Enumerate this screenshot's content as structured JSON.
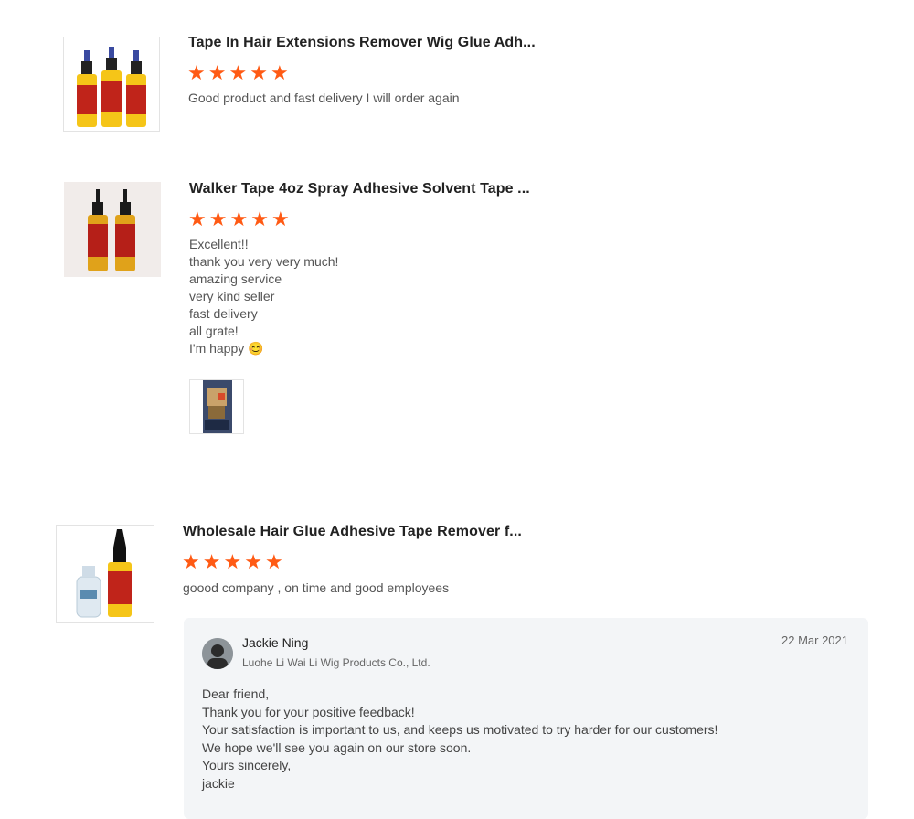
{
  "reviews": [
    {
      "product_title": "Tape In Hair Extensions Remover Wig Glue Adh...",
      "rating": 5,
      "text": "Good product and fast delivery I will order again"
    },
    {
      "product_title": "Walker Tape 4oz Spray Adhesive Solvent Tape ...",
      "rating": 5,
      "text": "Excellent!!\nthank you very very much!\namazing service\nvery kind seller\nfast delivery\nall grate!\nI'm happy 😊"
    },
    {
      "product_title": "Wholesale Hair Glue Adhesive Tape Remover f...",
      "rating": 5,
      "text": "goood company , on time and good employees"
    }
  ],
  "seller_reply": {
    "name": "Jackie Ning",
    "company": "Luohe Li Wai Li Wig Products Co., Ltd.",
    "date": "22 Mar 2021",
    "text": "Dear friend,\nThank you for your positive feedback!\nYour satisfaction is important to us, and keeps us motivated to try harder for our customers!\nWe hope we'll see you again on our store soon.\nYours sincerely,\njackie"
  },
  "colors": {
    "star": "#ff5a14",
    "bottle_label": "#c0241a",
    "bottle_liquid": "#f5c518"
  }
}
